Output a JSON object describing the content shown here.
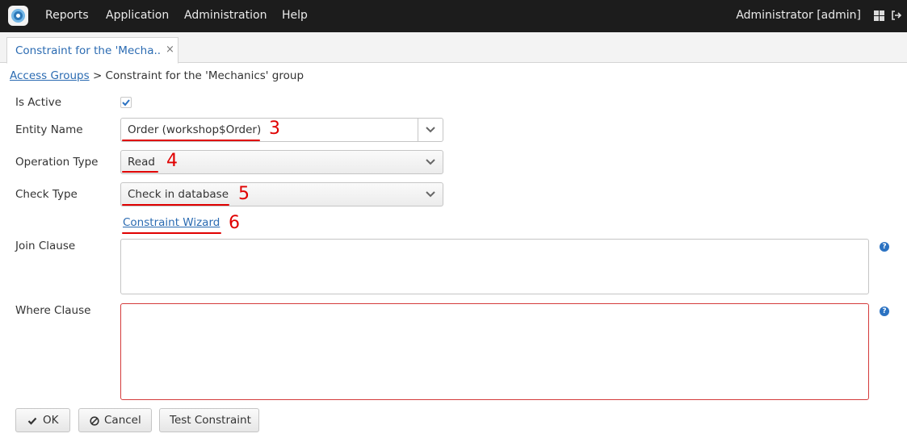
{
  "topbar": {
    "menu": [
      "Reports",
      "Application",
      "Administration",
      "Help"
    ],
    "user": "Administrator [admin]"
  },
  "tab": {
    "label": "Constraint for the 'Mecha...",
    "close": "×"
  },
  "breadcrumb": {
    "link": "Access Groups",
    "separator": ">",
    "current": "Constraint for the 'Mechanics' group"
  },
  "form": {
    "is_active_label": "Is Active",
    "is_active_checked": true,
    "entity_name_label": "Entity Name",
    "entity_name_value": "Order (workshop$Order)",
    "operation_type_label": "Operation Type",
    "operation_type_value": "Read",
    "check_type_label": "Check Type",
    "check_type_value": "Check in database",
    "wizard_link": "Constraint Wizard",
    "join_clause_label": "Join Clause",
    "join_clause_value": "",
    "where_clause_label": "Where Clause",
    "where_clause_value": "",
    "help_glyph": "?"
  },
  "buttons": {
    "ok": "OK",
    "cancel": "Cancel",
    "test": "Test Constraint"
  },
  "annotations": [
    "3",
    "4",
    "5",
    "6"
  ],
  "colors": {
    "topbar": "#1c1c1c",
    "link": "#2b6bb2",
    "annotation": "#e00000",
    "invalid_border": "#d43b3b"
  }
}
